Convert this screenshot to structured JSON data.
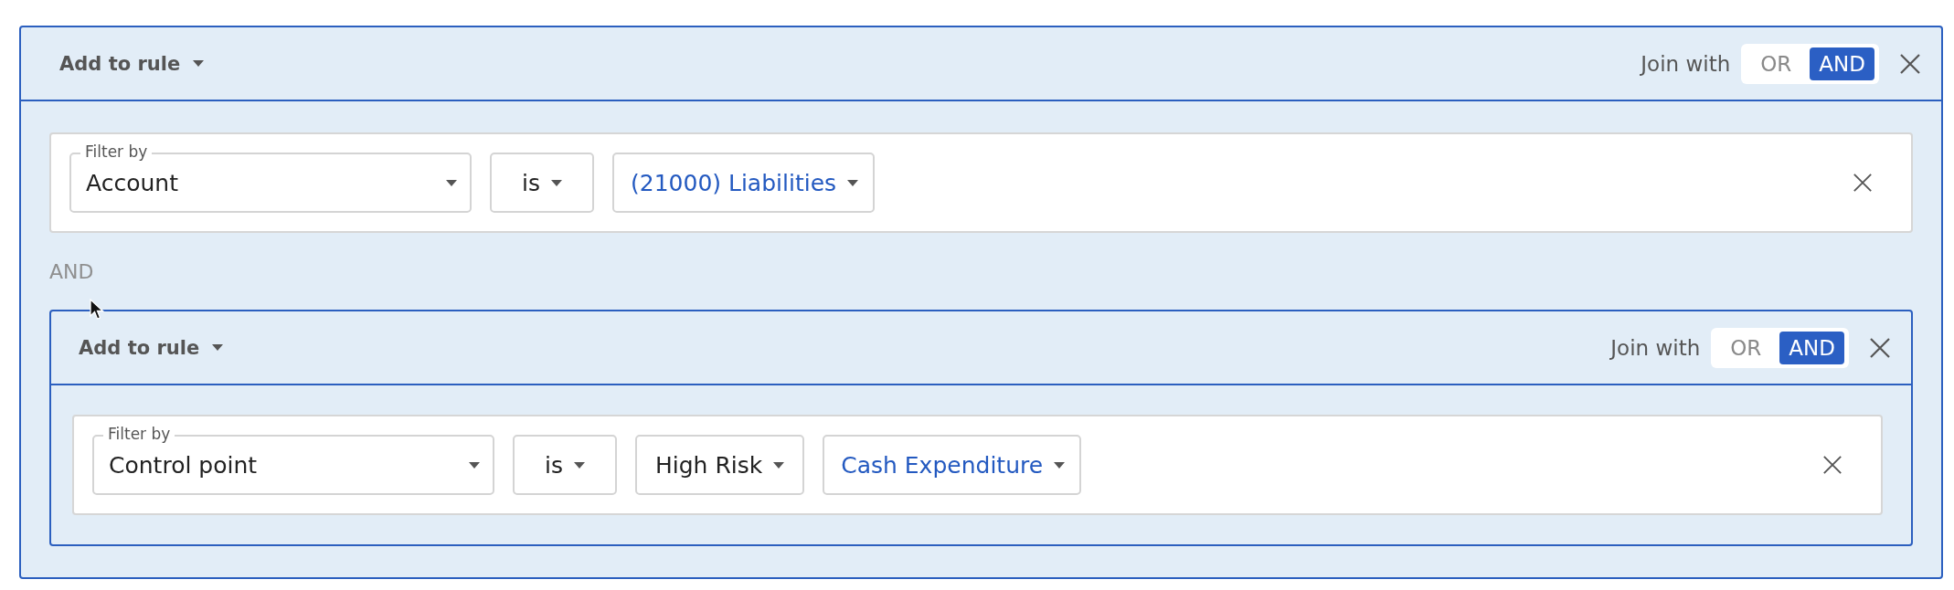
{
  "group": {
    "header": {
      "add_label": "Add to rule",
      "join_label": "Join with",
      "join_options": [
        {
          "label": "OR",
          "selected": false
        },
        {
          "label": "AND",
          "selected": true
        }
      ]
    },
    "items": [
      {
        "kind": "filter",
        "field_label": "Filter by",
        "field": "Account",
        "operator": "is",
        "values": [
          {
            "kind": "link",
            "text": "(21000) Liabilities"
          }
        ]
      },
      {
        "kind": "connector",
        "label": "AND"
      },
      {
        "kind": "group",
        "header": {
          "add_label": "Add to rule",
          "join_label": "Join with",
          "join_options": [
            {
              "label": "OR",
              "selected": false
            },
            {
              "label": "AND",
              "selected": true
            }
          ]
        },
        "items": [
          {
            "kind": "filter",
            "field_label": "Filter by",
            "field": "Control point",
            "operator": "is",
            "values": [
              {
                "kind": "plain",
                "text": "High Risk"
              },
              {
                "kind": "link",
                "text": "Cash Expenditure"
              }
            ]
          }
        ]
      }
    ]
  }
}
